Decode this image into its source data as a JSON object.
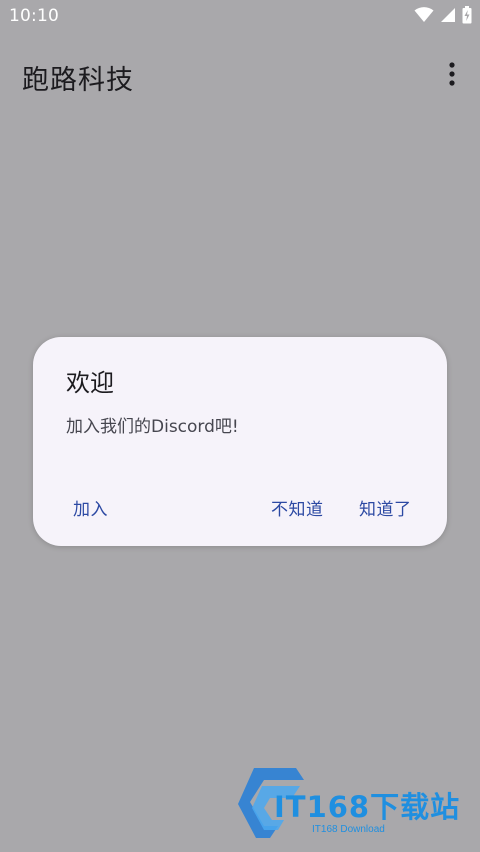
{
  "status_bar": {
    "time": "10:10"
  },
  "app_bar": {
    "title": "跑路科技"
  },
  "dialog": {
    "title": "欢迎",
    "message": "加入我们的Discord吧!",
    "buttons": {
      "join": "加入",
      "dont_know": "不知道",
      "got_it": "知道了"
    }
  },
  "watermark": {
    "brand": "IT168下载站",
    "sub": "IT168 Download"
  },
  "colors": {
    "scrim_background": "#a9a8ab",
    "dialog_surface": "#f6f3fa",
    "button_text": "#2c49a3",
    "watermark_blue": "#1f8fe0"
  }
}
